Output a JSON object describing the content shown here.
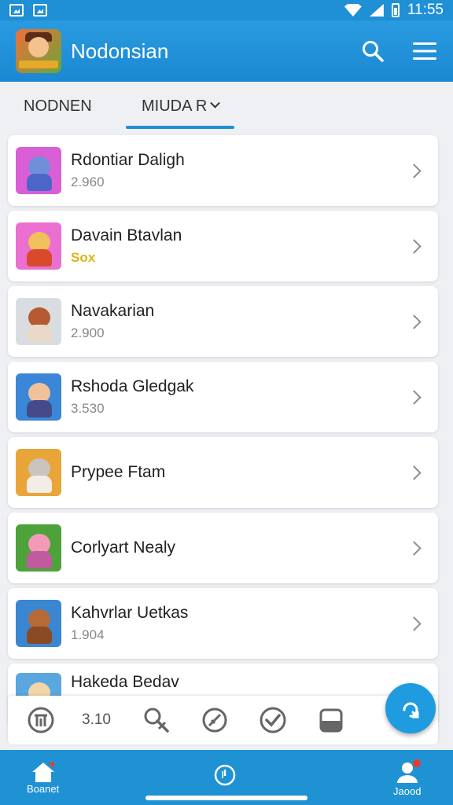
{
  "status_bar": {
    "time": "11:55"
  },
  "app_bar": {
    "title": "Nodonsian"
  },
  "tabs": [
    {
      "label": "NODNEN"
    },
    {
      "label": "MIUDA R"
    }
  ],
  "items": [
    {
      "name": "Rdontiar Daligh",
      "sub": "2.960",
      "thumb_bg": "#d95fd6",
      "head": "#6f8fd8",
      "body": "#4b66c8"
    },
    {
      "name": "Davain Btavlan",
      "sub": "Sox",
      "thumb_bg": "#ea6fd0",
      "head": "#f0c05a",
      "body": "#d84a2b"
    },
    {
      "name": "Navakarian",
      "sub": "2.900",
      "thumb_bg": "#d9dde2",
      "head": "#b65a32",
      "body": "#e8d9c9"
    },
    {
      "name": "Rshoda Gledgak",
      "sub": "3.530",
      "thumb_bg": "#3c86d8",
      "head": "#f0c29a",
      "body": "#444a8a"
    },
    {
      "name": "Prypee Ftam",
      "sub": "",
      "thumb_bg": "#e9a53a",
      "head": "#c9c4bd",
      "body": "#f2ede6"
    },
    {
      "name": "Corlyart Nealy",
      "sub": "",
      "thumb_bg": "#4ea23a",
      "head": "#f29ab8",
      "body": "#c25aa0"
    },
    {
      "name": "Kahvrlar Uetkas",
      "sub": "1.904",
      "thumb_bg": "#3b86d0",
      "head": "#b86a36",
      "body": "#8a4a24"
    },
    {
      "name": "Hakeda Bedav",
      "sub": "",
      "thumb_bg": "#5aa7e0",
      "head": "#f3d6a8",
      "body": "#e9b97a"
    }
  ],
  "toolbar": {
    "count": "3.10"
  },
  "bottom_nav": {
    "home_label": "Boanet",
    "profile_label": "Jaood"
  }
}
